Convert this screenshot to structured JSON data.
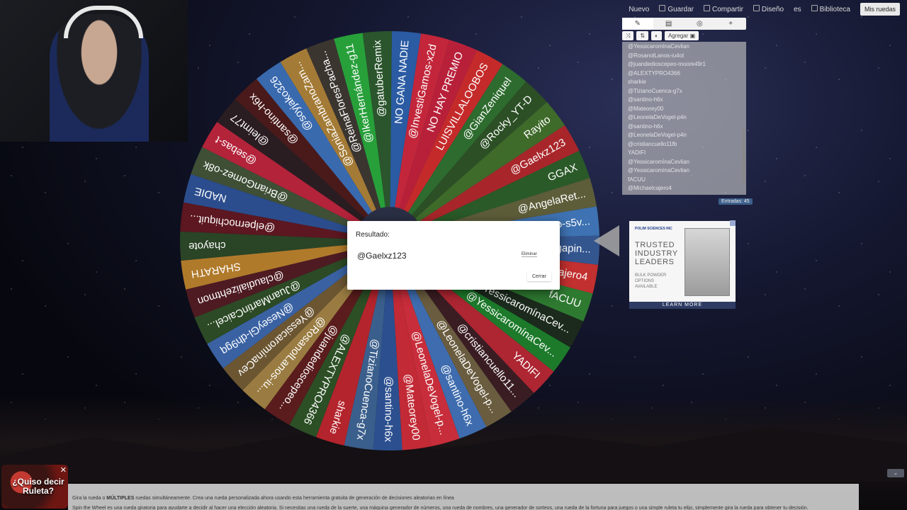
{
  "topbar": {
    "new": "Nuevo",
    "save": "Guardar",
    "share": "Compartir",
    "design": "Diseño",
    "lang": "es",
    "library": "Biblioteca",
    "my_wheels": "Mis ruedas"
  },
  "wheel": {
    "segments": [
      {
        "label": "NO GANA NADIE",
        "color": "#2a5ba3"
      },
      {
        "label": "@InvestiGamos-x2d",
        "color": "#c3263a"
      },
      {
        "label": "NO HAY PREMIO",
        "color": "#b8203a"
      },
      {
        "label": "LUISVILLALOOBOS",
        "color": "#c52a2a"
      },
      {
        "label": "@GianZeniquel",
        "color": "#2e6b2e"
      },
      {
        "label": "@Rocky_YT-D",
        "color": "#2c4f25"
      },
      {
        "label": "Rayito",
        "color": "#3f6b2a"
      },
      {
        "label": "@Gaelxz123",
        "color": "#a8262a"
      },
      {
        "label": "GGAX",
        "color": "#2a5a28"
      },
      {
        "label": "@AngelaRet...",
        "color": "#5d5d3a"
      },
      {
        "label": "@JessicaBravo-s5v...",
        "color": "#3e72b2"
      },
      {
        "label": "@yarellyortegapin...",
        "color": "#34568f"
      },
      {
        "label": "@Michaelcajero4",
        "color": "#c23030"
      },
      {
        "label": "fACUU",
        "color": "#2e7a31"
      },
      {
        "label": "@YessicaromínaCev...",
        "color": "#1b2a1c"
      },
      {
        "label": "@YessicaromínaCev...",
        "color": "#1c7a2a"
      },
      {
        "label": "YADIFI",
        "color": "#ad2632"
      },
      {
        "label": "@cristiancuello11...",
        "color": "#3a1d22"
      },
      {
        "label": "@LeonelaDeVogel-p...",
        "color": "#6a5c3f"
      },
      {
        "label": "@santino-h6x",
        "color": "#3e6cae"
      },
      {
        "label": "@LeonelaDeVogel-p...",
        "color": "#c72d3a"
      },
      {
        "label": "@Mateorey00",
        "color": "#c22a35"
      },
      {
        "label": "@santino-h6x",
        "color": "#2c4f8f"
      },
      {
        "label": "@TizianoCuenca-g7x",
        "color": "#3b5f8c"
      },
      {
        "label": "sharkie",
        "color": "#b4242c"
      },
      {
        "label": "@ALEXTYPRO4366",
        "color": "#2c4f25"
      },
      {
        "label": "@juandedioscepeo...",
        "color": "#5a1c1c"
      },
      {
        "label": "@RosanolLanos-iu...",
        "color": "#9a7c42"
      },
      {
        "label": "@YessicaromínaCev",
        "color": "#6c5632"
      },
      {
        "label": "@NeseyGl-dh9gq",
        "color": "#3a62a3"
      },
      {
        "label": "@JuanMartinCaicel...",
        "color": "#2c4a25"
      },
      {
        "label": "@claudializehtmon",
        "color": "#4e1b22"
      },
      {
        "label": "SHARATH",
        "color": "#b07a2b"
      },
      {
        "label": "chayote",
        "color": "#2a4426"
      },
      {
        "label": "@elpernochiquit...",
        "color": "#5c1720"
      },
      {
        "label": "NADIE",
        "color": "#2b4d8d"
      },
      {
        "label": "@BrianGomez-o8k",
        "color": "#3f4f36"
      },
      {
        "label": "@sebas-t",
        "color": "#b3233a"
      },
      {
        "label": "@leimt77",
        "color": "#2a1d21"
      },
      {
        "label": "@santino-h6x",
        "color": "#4a1a1a"
      },
      {
        "label": "@soyjako326",
        "color": "#3a6aae"
      },
      {
        "label": "@SoniaZambranoZam...",
        "color": "#a47b36"
      },
      {
        "label": "@ReinaFloresPacha...",
        "color": "#3b3530"
      },
      {
        "label": "@IkerHernández-g11",
        "color": "#27a03a"
      },
      {
        "label": "@gatuberRemix",
        "color": "#2b552c"
      }
    ]
  },
  "panel": {
    "tabs": [
      "✎",
      "▤",
      "◎",
      "+"
    ],
    "tools": [
      "⤨",
      "⇅",
      "◐",
      "Agregar ▣"
    ],
    "entries": [
      "@YessicaromínaCevlian",
      "@RosanolLanos-iu4ot",
      "@juandedioscepeo-moore49r1",
      "@ALEXTYPRO4366",
      "sharkie",
      "@TizianoCuenca-g7x",
      "@santino-h6x",
      "@Mateorey00",
      "@LeonelaDeVogel-p4n",
      "@santino-h6x",
      "@LeonelaDeVogel-p4n",
      "@cristiancuello11fb",
      "YADIFI",
      "@YessicaromínaCevlian",
      "@YessicaromínaCevlian",
      "fACUU",
      "@Michaelcajero4"
    ],
    "count_label": "Entradas: 45"
  },
  "ad": {
    "brand": "POLIM SCIENCES INC",
    "headline": "TRUSTED INDUSTRY LEADERS",
    "subtext": "BULK POWDER OPTIONS AVAILABLE",
    "cta": "LEARN MORE"
  },
  "dialog": {
    "title": "Resultado:",
    "value": "@Gaelxz123",
    "remove": "Eliminar",
    "close": "Cerrar"
  },
  "footer": {
    "line1_pre": "Gira la rueda o ",
    "line1_bold": "MÚLTIPLES",
    "line1_post": " ruedas simultáneamente. Crea una rueda personalizada ahora usando esta herramienta gratuita de generación de decisiones aleatorias en línea",
    "line2": "Spin the Wheel es una rueda giratoria para ayudarte a decidir al hacer una elección aleatoria. Si necesitas una rueda de la suerte, una máquina generador de números, una rueda de nombres, una generador de sorteos, una rueda de la fortuna para juegos o una simple ruleta tu elijo, simplemente gira la rueda para obtener tu decisión."
  },
  "suggestion": {
    "text": "¿Quiso decir Ruleta?",
    "close": "✕"
  }
}
